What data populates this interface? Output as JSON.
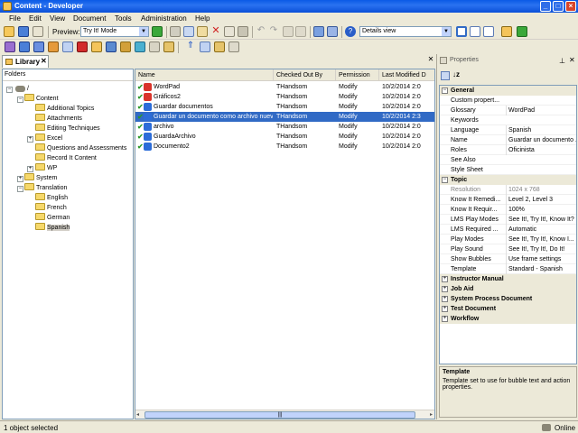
{
  "window": {
    "title": "Content - Developer"
  },
  "menu": [
    "File",
    "Edit",
    "View",
    "Document",
    "Tools",
    "Administration",
    "Help"
  ],
  "toolbar": {
    "preview_label": "Preview:",
    "preview_value": "Try It! Mode",
    "view_value": "Details view"
  },
  "tabs": {
    "library_label": "Library"
  },
  "folders": {
    "header": "Folders",
    "items": [
      {
        "label": "/"
      },
      {
        "label": "Content"
      },
      {
        "label": "Additional Topics"
      },
      {
        "label": "Attachments"
      },
      {
        "label": "Editing Techniques"
      },
      {
        "label": "Excel"
      },
      {
        "label": "Questions and Assessments"
      },
      {
        "label": "Record It Content"
      },
      {
        "label": "WP"
      },
      {
        "label": "System"
      },
      {
        "label": "Translation"
      },
      {
        "label": "English"
      },
      {
        "label": "French"
      },
      {
        "label": "German"
      },
      {
        "label": "Spanish"
      }
    ]
  },
  "files": {
    "columns": [
      "Name",
      "Checked Out By",
      "Permission",
      "Last Modified D"
    ],
    "rows": [
      {
        "name": "WordPad",
        "checked": "THandsom",
        "perm": "Modify",
        "date": "10/2/2014 2:0",
        "icon_color": "#d9342b"
      },
      {
        "name": "Gráficos2",
        "checked": "THandsom",
        "perm": "Modify",
        "date": "10/2/2014 2:0",
        "icon_color": "#d9342b"
      },
      {
        "name": "Guardar documentos",
        "checked": "THandsom",
        "perm": "Modify",
        "date": "10/2/2014 2:0",
        "icon_color": "#2c6cd8"
      },
      {
        "name": "Guardar un documento como archivo nuevo",
        "checked": "THandsom",
        "perm": "Modify",
        "date": "10/2/2014 2:3",
        "icon_color": "#2c6cd8"
      },
      {
        "name": "archivo",
        "checked": "THandsom",
        "perm": "Modify",
        "date": "10/2/2014 2:0",
        "icon_color": "#2c6cd8"
      },
      {
        "name": "GuardaArchivo",
        "checked": "THandsom",
        "perm": "Modify",
        "date": "10/2/2014 2:0",
        "icon_color": "#2c6cd8"
      },
      {
        "name": "Documento2",
        "checked": "THandsom",
        "perm": "Modify",
        "date": "10/2/2014 2:0",
        "icon_color": "#2c6cd8"
      }
    ]
  },
  "properties": {
    "title": "Properties",
    "groups": [
      {
        "name": "General",
        "expanded": true,
        "rows": [
          {
            "k": "Custom propert...",
            "v": ""
          },
          {
            "k": "Glossary",
            "v": "WordPad"
          },
          {
            "k": "Keywords",
            "v": ""
          },
          {
            "k": "Language",
            "v": "Spanish"
          },
          {
            "k": "Name",
            "v": "Guardar un documento ..."
          },
          {
            "k": "Roles",
            "v": "Oficinista"
          },
          {
            "k": "See Also",
            "v": ""
          },
          {
            "k": "Style Sheet",
            "v": ""
          }
        ]
      },
      {
        "name": "Topic",
        "expanded": true,
        "rows": [
          {
            "k": "Resolution",
            "v": "1024 x 768",
            "dim": true
          },
          {
            "k": "Know It Remedi...",
            "v": "Level 2, Level 3"
          },
          {
            "k": "Know It Requir...",
            "v": "100%"
          },
          {
            "k": "LMS Play Modes",
            "v": "See It!, Try It!, Know It?"
          },
          {
            "k": "LMS Required ...",
            "v": "Automatic"
          },
          {
            "k": "Play Modes",
            "v": "See It!, Try It!, Know I..."
          },
          {
            "k": "Play Sound",
            "v": "See It!, Try It!, Do It!"
          },
          {
            "k": "Show Bubbles",
            "v": "Use frame settings"
          },
          {
            "k": "Template",
            "v": "Standard - Spanish"
          }
        ]
      },
      {
        "name": "Instructor Manual",
        "expanded": false,
        "rows": []
      },
      {
        "name": "Job Aid",
        "expanded": false,
        "rows": []
      },
      {
        "name": "System Process Document",
        "expanded": false,
        "rows": []
      },
      {
        "name": "Test Document",
        "expanded": false,
        "rows": []
      },
      {
        "name": "Workflow",
        "expanded": false,
        "rows": []
      }
    ],
    "description_title": "Template",
    "description_text": "Template set to use for bubble text and action properties."
  },
  "status": {
    "left": "1 object selected",
    "right": "Online"
  },
  "colors": {
    "accent": "#316ac5",
    "title_bar": "#0a5ae6"
  }
}
